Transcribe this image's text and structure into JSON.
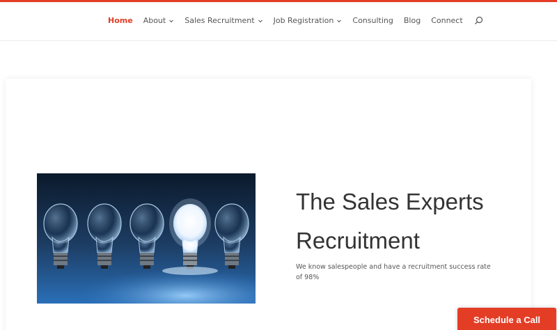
{
  "nav": {
    "items": [
      {
        "label": "Home",
        "active": true,
        "dropdown": false
      },
      {
        "label": "About",
        "active": false,
        "dropdown": true
      },
      {
        "label": "Sales Recruitment",
        "active": false,
        "dropdown": true
      },
      {
        "label": "Job Registration",
        "active": false,
        "dropdown": true
      },
      {
        "label": "Consulting",
        "active": false,
        "dropdown": false
      },
      {
        "label": "Blog",
        "active": false,
        "dropdown": false
      },
      {
        "label": "Connect",
        "active": false,
        "dropdown": false
      }
    ],
    "search_icon": "search-icon"
  },
  "hero": {
    "title_line1": "The Sales Experts",
    "title_line2": "Recruitment",
    "subtitle": "We know salespeople and have a recruitment success rate of 98%",
    "image": "lightbulbs-image"
  },
  "cta": {
    "label": "Schedule a Call"
  },
  "colors": {
    "accent": "#e33d26",
    "text": "#333333",
    "nav_text": "#555555"
  }
}
